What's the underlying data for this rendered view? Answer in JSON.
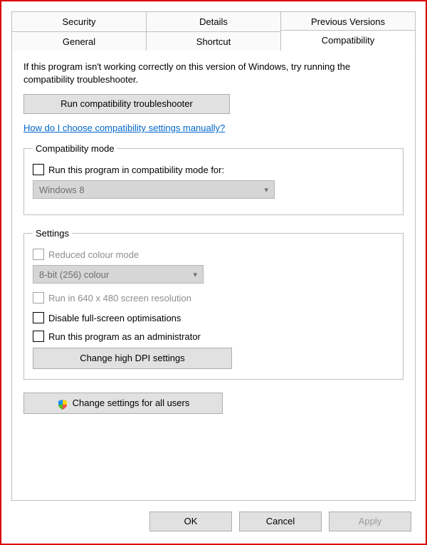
{
  "tabs": {
    "row1": [
      "Security",
      "Details",
      "Previous Versions"
    ],
    "row2": [
      "General",
      "Shortcut",
      "Compatibility"
    ],
    "active": "Compatibility"
  },
  "intro": "If this program isn't working correctly on this version of Windows, try running the compatibility troubleshooter.",
  "run_troubleshooter": "Run compatibility troubleshooter",
  "help_link": "How do I choose compatibility settings manually?",
  "compat_mode": {
    "legend": "Compatibility mode",
    "checkbox": "Run this program in compatibility mode for:",
    "dropdown": "Windows 8"
  },
  "settings": {
    "legend": "Settings",
    "reduced_colour": "Reduced colour mode",
    "colour_dropdown": "8-bit (256) colour",
    "low_res": "Run in 640 x 480 screen resolution",
    "disable_fullscreen": "Disable full-screen optimisations",
    "run_admin": "Run this program as an administrator",
    "high_dpi": "Change high DPI settings"
  },
  "change_all_users": "Change settings for all users",
  "buttons": {
    "ok": "OK",
    "cancel": "Cancel",
    "apply": "Apply"
  }
}
